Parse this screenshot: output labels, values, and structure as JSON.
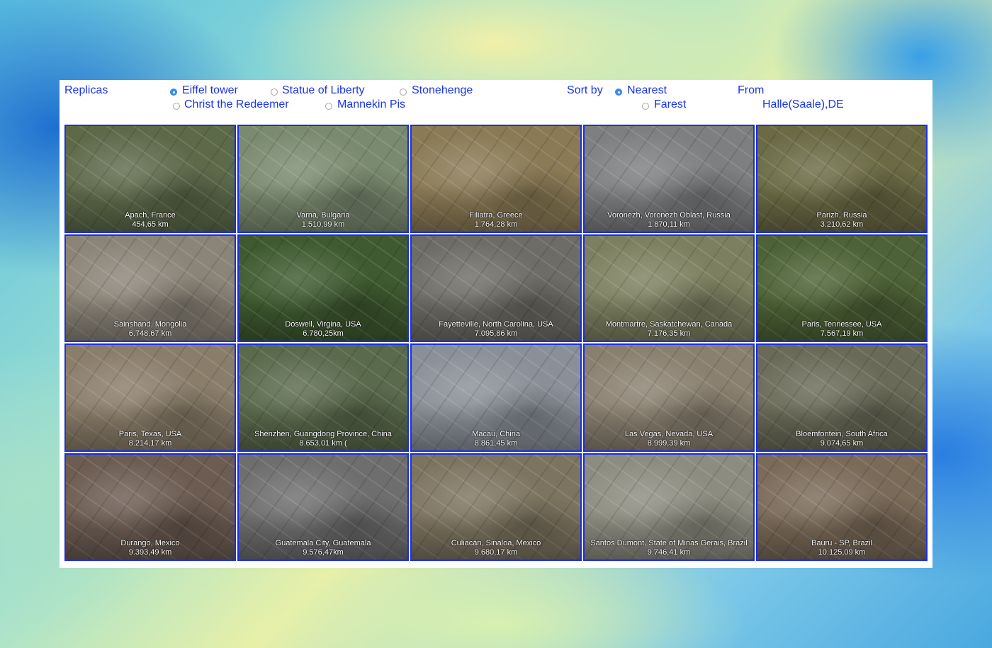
{
  "header": {
    "replicas_label": "Replicas",
    "options": [
      {
        "label": "Eiffel tower",
        "selected": true
      },
      {
        "label": "Statue of Liberty",
        "selected": false
      },
      {
        "label": "Stonehenge",
        "selected": false
      },
      {
        "label": "Christ the Redeemer",
        "selected": false
      },
      {
        "label": "Mannekin Pis",
        "selected": false
      }
    ],
    "sort_label": "Sort by",
    "sort_options": [
      {
        "label": "Nearest",
        "selected": true
      },
      {
        "label": "Farest",
        "selected": false
      }
    ],
    "from_label": "From",
    "from_value": "Halle(Saale),DE"
  },
  "tiles": [
    {
      "place": "Apach, France",
      "distance": "454,65 km",
      "color": "#5d6a4a"
    },
    {
      "place": "Varna, Bulgaria",
      "distance": "1.510,99 km",
      "color": "#7a8a70"
    },
    {
      "place": "Filiatra, Greece",
      "distance": "1.764,28 km",
      "color": "#8a7a55"
    },
    {
      "place": "Voronezh, Voronezh Oblast, Russia",
      "distance": "1.870,11 km",
      "color": "#7d7f80"
    },
    {
      "place": "Parizh, Russia",
      "distance": "3.210,62 km",
      "color": "#6b6a45"
    },
    {
      "place": "Sainshand, Mongolia",
      "distance": "6.748,67 km",
      "color": "#8b8478"
    },
    {
      "place": "Doswell, Virgina, USA",
      "distance": "6.780,25km",
      "color": "#3f5a30"
    },
    {
      "place": "Fayetteville, North Carolina, USA",
      "distance": "7.095,86 km",
      "color": "#6e6c66"
    },
    {
      "place": "Montmartre, Saskatchewan, Canada",
      "distance": "7.176,35 km",
      "color": "#7d8060"
    },
    {
      "place": "Paris, Tennessee, USA",
      "distance": "7.567,19 km",
      "color": "#4d6236"
    },
    {
      "place": "Paris, Texas, USA",
      "distance": "8.214,17 km",
      "color": "#8a7d6a"
    },
    {
      "place": "Shenzhen, Guangdong Province, China",
      "distance": "8.653,01 km (",
      "color": "#5a6a4c"
    },
    {
      "place": "Macau, China",
      "distance": "8.861,45 km",
      "color": "#8a9098"
    },
    {
      "place": "Las Vegas, Nevada, USA",
      "distance": "8.999,39 km",
      "color": "#8a8070"
    },
    {
      "place": "Bloemfontein, South Africa",
      "distance": "9.074,65 km",
      "color": "#6a6a58"
    },
    {
      "place": "Durango, Mexico",
      "distance": "9.393,49 km",
      "color": "#6c5c52"
    },
    {
      "place": "Guatemala City, Guatemala",
      "distance": "9.576,47km",
      "color": "#6e6e6e"
    },
    {
      "place": "Culiacán, Sinaloa, Mexico",
      "distance": "9.680,17 km",
      "color": "#7d7460"
    },
    {
      "place": "Santos Dumont, State of Minas Gerais, Brazil",
      "distance": "9.746,41 km",
      "color": "#8c8c80"
    },
    {
      "place": "Bauru - SP, Brazil",
      "distance": "10.125,09 km",
      "color": "#7a6a58"
    }
  ]
}
